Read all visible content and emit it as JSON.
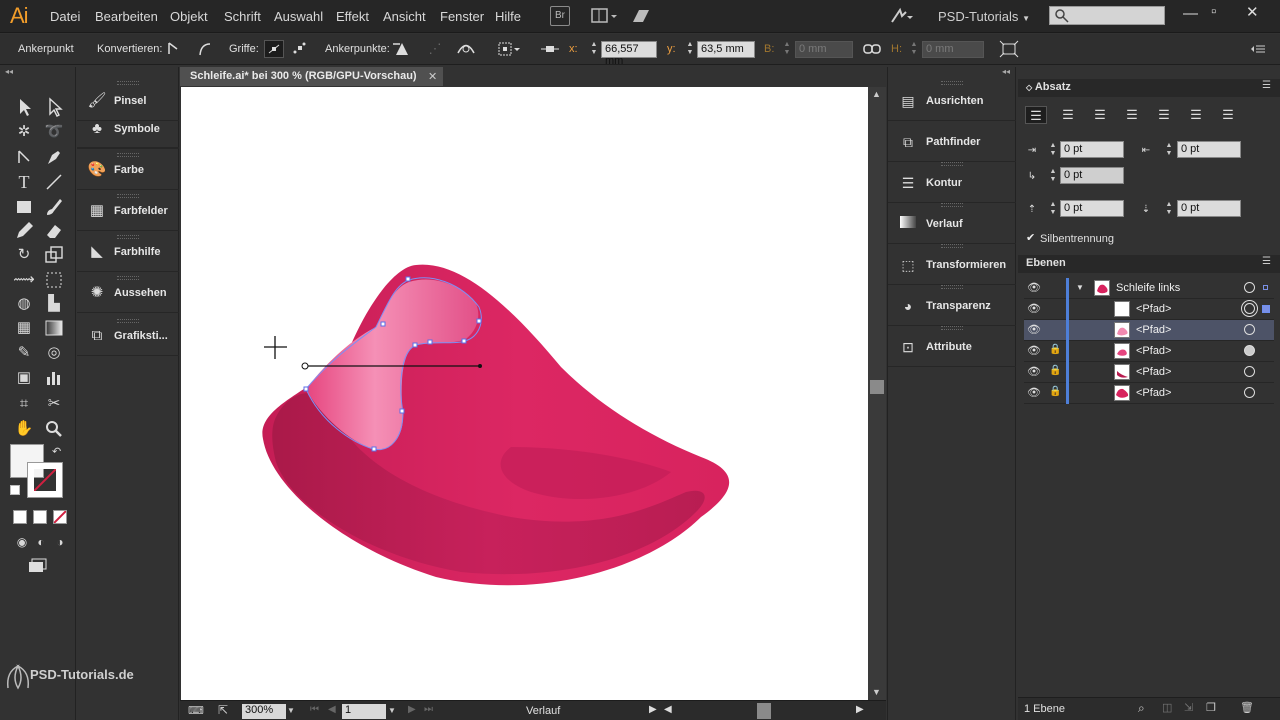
{
  "menubar": {
    "logo": "Ai",
    "items": [
      "Datei",
      "Bearbeiten",
      "Objekt",
      "Schrift",
      "Auswahl",
      "Effekt",
      "Ansicht",
      "Fenster",
      "Hilfe"
    ],
    "bridge_label": "Br",
    "workspace": "PSD-Tutorials"
  },
  "control": {
    "mode": "Ankerpunkt",
    "convert_label": "Konvertieren:",
    "handles_label": "Griffe:",
    "anchors_label": "Ankerpunkte:",
    "x_label": "x:",
    "x_value": "66,557 mm",
    "y_label": "y:",
    "y_value": "63,5 mm",
    "w_label": "B:",
    "w_value": "0 mm",
    "h_label": "H:",
    "h_value": "0 mm"
  },
  "left_panels": [
    "Pinsel",
    "Symbole",
    "Farbe",
    "Farbfelder",
    "Farbhilfe",
    "Aussehen",
    "Grafiksti..."
  ],
  "document": {
    "tab_title": "Schleife.ai* bei 300 % (RGB/GPU-Vorschau)",
    "zoom": "300%",
    "artboard": "1",
    "status": "Verlauf"
  },
  "mid_panels": [
    "Ausrichten",
    "Pathfinder",
    "Kontur",
    "Verlauf",
    "Transformieren",
    "Transparenz",
    "Attribute"
  ],
  "paragraph": {
    "title": "Absatz",
    "left_indent": "0 pt",
    "right_indent": "0 pt",
    "first_line": "0 pt",
    "space_before": "0 pt",
    "space_after": "0 pt",
    "hyphenation": "Silbentrennung"
  },
  "layers": {
    "title": "Ebenen",
    "group": "Schleife links",
    "items": [
      "<Pfad>",
      "<Pfad>",
      "<Pfad>",
      "<Pfad>",
      "<Pfad>"
    ],
    "footer": "1 Ebene"
  },
  "brand": "PSD-Tutorials.de",
  "colors": {
    "accent": "#f29d2a",
    "shape_main": "#d8235e",
    "shape_dark": "#b81d50",
    "shape_light": "#f28ab0",
    "layer_selected": "#4d5367",
    "layer_bar": "#4e7fd8"
  }
}
